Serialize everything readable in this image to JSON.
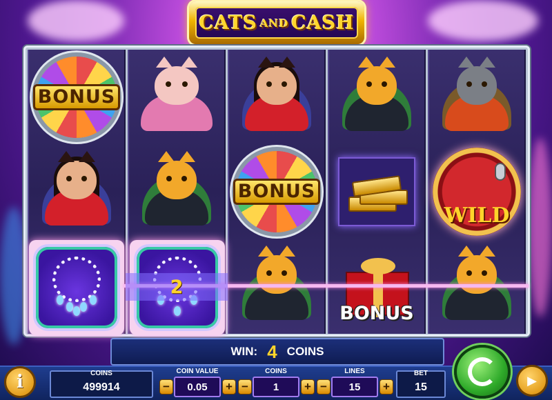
{
  "game": {
    "title_left": "CATS",
    "title_mid": "AND",
    "title_right": "CASH"
  },
  "symbols": {
    "bonus": "BONUS",
    "wild": "WILD"
  },
  "payline": {
    "value": "2"
  },
  "win": {
    "label": "WIN:",
    "amount": "4",
    "unit": "COINS"
  },
  "controls": {
    "info_label": "i",
    "coins_label": "COINS",
    "coins_value": "499914",
    "coin_value_label": "COIN VALUE",
    "coin_value": "0.05",
    "coins_bet_label": "COINS",
    "coins_bet": "1",
    "lines_label": "LINES",
    "lines": "15",
    "bet_label": "BET",
    "bet": "15",
    "minus": "−",
    "plus": "+",
    "autoplay_symbol": "▶"
  }
}
